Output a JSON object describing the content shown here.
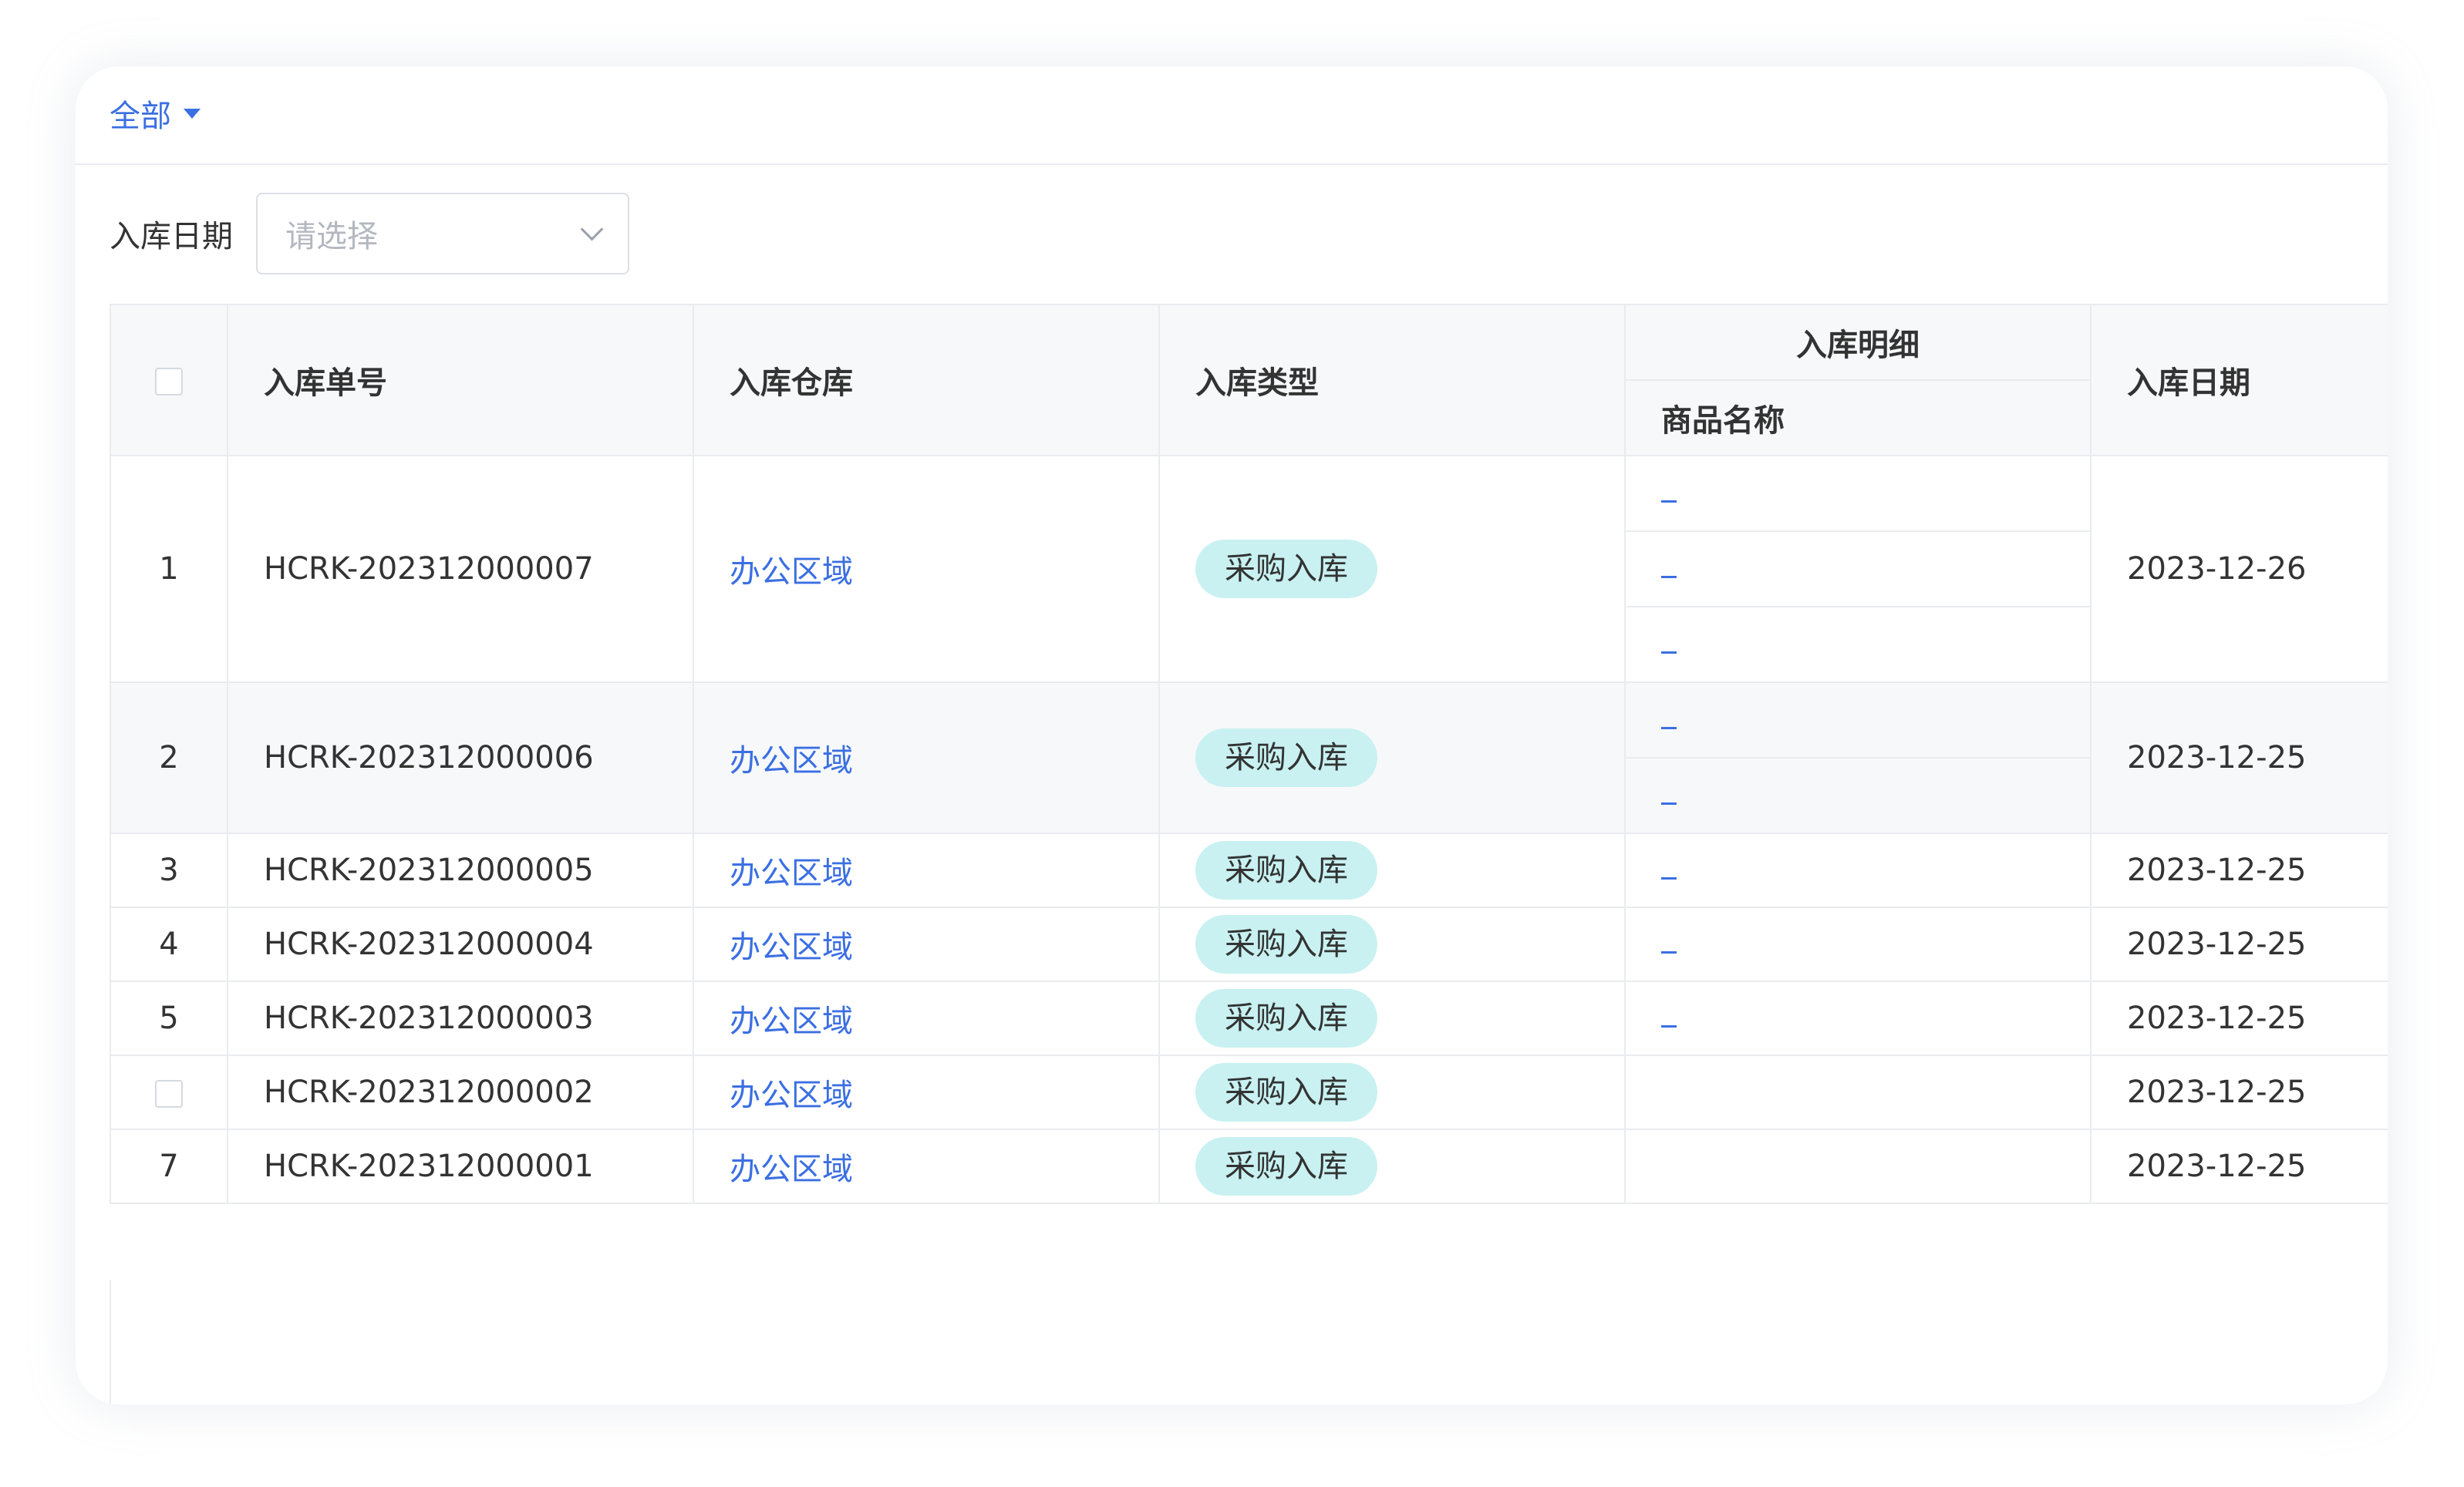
{
  "filter_all": {
    "label": "全部"
  },
  "date_filter": {
    "label": "入库日期",
    "placeholder": "请选择"
  },
  "table": {
    "headers": {
      "order_no": "入库单号",
      "warehouse": "入库仓库",
      "type": "入库类型",
      "detail_group": "入库明细",
      "product_name": "商品名称",
      "date": "入库日期"
    },
    "rows": [
      {
        "index": "1",
        "order_no": "HCRK-202312000007",
        "warehouse": "办公区域",
        "type": "采购入库",
        "detail_count": 3,
        "date": "2023-12-26"
      },
      {
        "index": "2",
        "order_no": "HCRK-202312000006",
        "warehouse": "办公区域",
        "type": "采购入库",
        "detail_count": 2,
        "date": "2023-12-25"
      },
      {
        "index": "3",
        "order_no": "HCRK-202312000005",
        "warehouse": "办公区域",
        "type": "采购入库",
        "detail_count": 1,
        "date": "2023-12-25"
      },
      {
        "index": "4",
        "order_no": "HCRK-202312000004",
        "warehouse": "办公区域",
        "type": "采购入库",
        "detail_count": 1,
        "date": "2023-12-25"
      },
      {
        "index": "5",
        "order_no": "HCRK-202312000003",
        "warehouse": "办公区域",
        "type": "采购入库",
        "detail_count": 1,
        "date": "2023-12-25"
      },
      {
        "index": "",
        "order_no": "HCRK-202312000002",
        "warehouse": "办公区域",
        "type": "采购入库",
        "detail_count": 0,
        "date": "2023-12-25"
      },
      {
        "index": "7",
        "order_no": "HCRK-202312000001",
        "warehouse": "办公区域",
        "type": "采购入库",
        "detail_count": 0,
        "date": "2023-12-25"
      }
    ]
  },
  "colors": {
    "link": "#3b6fe2",
    "tag_bg": "#c9f1f1",
    "header_bg": "#f7f8fa",
    "border": "#e9ebef"
  }
}
